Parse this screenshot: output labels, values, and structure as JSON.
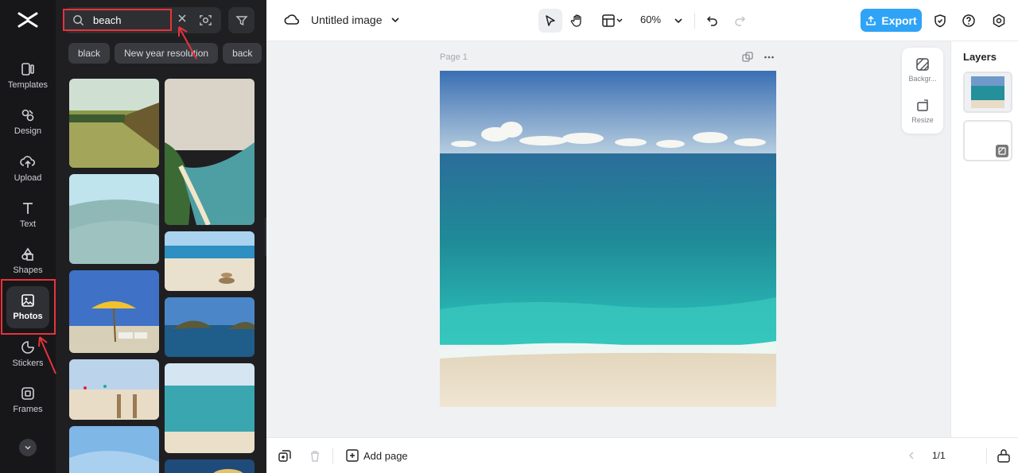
{
  "app": {
    "doc_title": "Untitled image",
    "zoom": "60%",
    "export_label": "Export"
  },
  "rail": {
    "items": [
      {
        "label": "Templates",
        "icon": "templates-icon"
      },
      {
        "label": "Design",
        "icon": "design-icon"
      },
      {
        "label": "Upload",
        "icon": "upload-icon"
      },
      {
        "label": "Text",
        "icon": "text-icon"
      },
      {
        "label": "Shapes",
        "icon": "shapes-icon"
      },
      {
        "label": "Photos",
        "icon": "photos-icon"
      },
      {
        "label": "Stickers",
        "icon": "stickers-icon"
      },
      {
        "label": "Frames",
        "icon": "frames-icon"
      }
    ]
  },
  "search": {
    "value": "beach",
    "tags": [
      "black",
      "New year resolution",
      "back"
    ]
  },
  "canvas": {
    "page_label": "Page 1",
    "side_tools": [
      "Backgr...",
      "Resize"
    ]
  },
  "layers": {
    "title": "Layers"
  },
  "bottom": {
    "add_page": "Add page",
    "pager": "1/1"
  },
  "colors": {
    "accent": "#2fa3f6",
    "highlight": "#e8333a",
    "rail_bg": "#17171a",
    "panel_bg": "#1f1f22"
  }
}
